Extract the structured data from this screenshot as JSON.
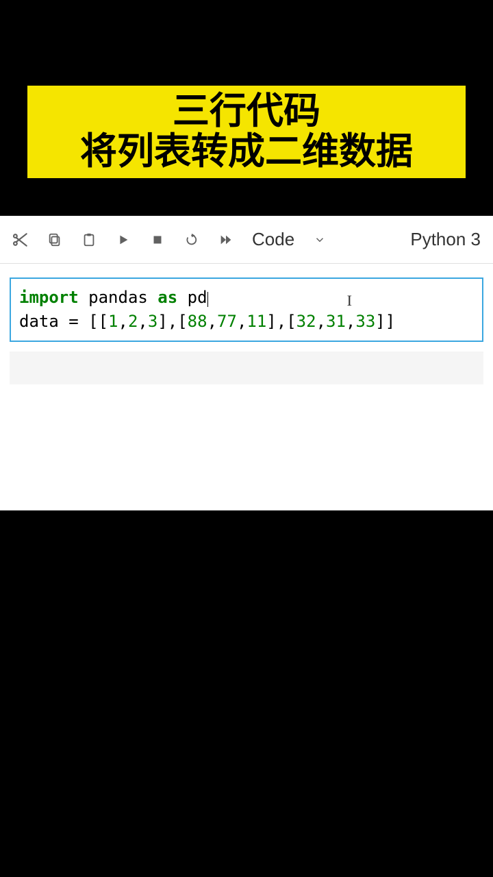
{
  "banner": {
    "line1": "三行代码",
    "line2": "将列表转成二维数据"
  },
  "toolbar": {
    "cellType": "Code",
    "kernel": "Python 3"
  },
  "code": {
    "kw_import": "import",
    "sp1": " pandas ",
    "kw_as": "as",
    "sp2": " pd",
    "line2_pre": "data = [[",
    "n1": "1",
    "c1": ",",
    "n2": "2",
    "c2": ",",
    "n3": "3",
    "c3": "],[",
    "n4": "88",
    "c4": ",",
    "n5": "77",
    "c5": ",",
    "n6": "11",
    "c6": "],[",
    "n7": "32",
    "c7": ",",
    "n8": "31",
    "c8": ",",
    "n9": "33",
    "c9": "]]"
  }
}
